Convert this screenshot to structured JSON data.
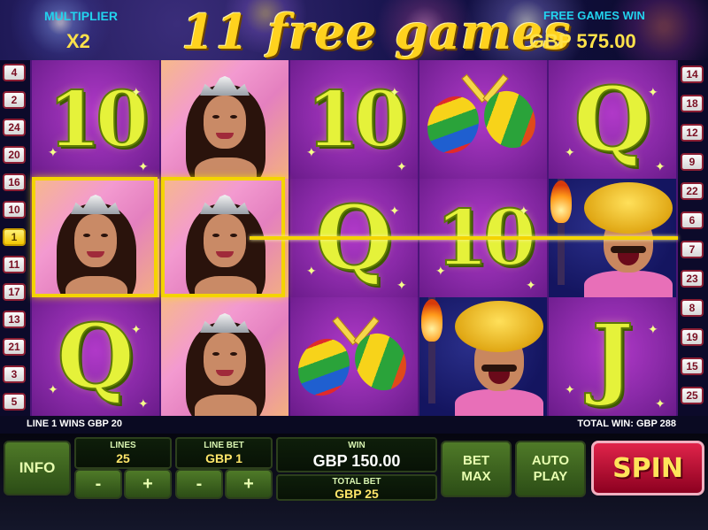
{
  "header": {
    "multiplier_label": "MULTIPLIER",
    "multiplier_value": "X2",
    "title": "11 free games",
    "free_games_win_label": "FREE GAMES WIN",
    "free_games_win_value": "GBP 575.00"
  },
  "paylines": {
    "left": [
      "4",
      "2",
      "24",
      "20",
      "16",
      "10",
      "1",
      "11",
      "17",
      "13",
      "21",
      "3",
      "5"
    ],
    "right": [
      "14",
      "18",
      "12",
      "9",
      "22",
      "6",
      "7",
      "23",
      "8",
      "19",
      "15",
      "25"
    ],
    "active": "1"
  },
  "reels": [
    [
      "10",
      "woman",
      "Q"
    ],
    [
      "woman",
      "woman",
      "woman"
    ],
    [
      "10",
      "Q",
      "maracas"
    ],
    [
      "maracas",
      "10",
      "man"
    ],
    [
      "Q",
      "man",
      "J"
    ]
  ],
  "status": {
    "line_win": "LINE 1 WINS GBP 20",
    "total_win": "TOTAL WIN: GBP 288"
  },
  "controls": {
    "info_label": "INFO",
    "lines_label": "LINES",
    "lines_value": "25",
    "line_bet_label": "LINE BET",
    "line_bet_value": "GBP 1",
    "minus_symbol": "-",
    "plus_symbol": "+",
    "win_label": "WIN",
    "win_value": "GBP 150.00",
    "total_bet_label": "TOTAL BET",
    "total_bet_value": "GBP 25",
    "bet_max_line1": "BET",
    "bet_max_line2": "MAX",
    "auto_play_line1": "AUTO",
    "auto_play_line2": "PLAY",
    "spin_label": "SPIN"
  },
  "colors": {
    "accent_yellow": "#f4d400",
    "reel_purple": "#8a2aa8",
    "badge_red": "#8c1e33",
    "spin_red": "#e0244a"
  }
}
